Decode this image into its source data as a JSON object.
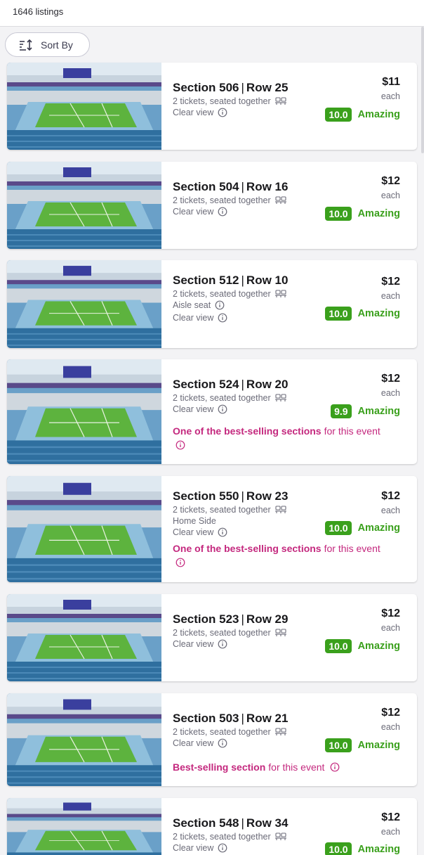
{
  "header": {
    "listing_count": "1646 listings"
  },
  "sort": {
    "label": "Sort By"
  },
  "colors": {
    "accent_green": "#3aa01c",
    "highlight_pink": "#c4287e"
  },
  "listings": [
    {
      "section": "Section 506",
      "row": "Row 25",
      "tickets": "2 tickets, seated together",
      "feature1": "Clear view",
      "feature2": "",
      "price": "$11",
      "each": "each",
      "score": "10.0",
      "rating_word": "Amazing",
      "best_bold": "",
      "best_rest": ""
    },
    {
      "section": "Section 504",
      "row": "Row 16",
      "tickets": "2 tickets, seated together",
      "feature1": "Clear view",
      "feature2": "",
      "price": "$12",
      "each": "each",
      "score": "10.0",
      "rating_word": "Amazing",
      "best_bold": "",
      "best_rest": ""
    },
    {
      "section": "Section 512",
      "row": "Row 10",
      "tickets": "2 tickets, seated together",
      "feature1": "Aisle seat",
      "feature2": "Clear view",
      "price": "$12",
      "each": "each",
      "score": "10.0",
      "rating_word": "Amazing",
      "best_bold": "",
      "best_rest": ""
    },
    {
      "section": "Section 524",
      "row": "Row 20",
      "tickets": "2 tickets, seated together",
      "feature1": "Clear view",
      "feature2": "",
      "price": "$12",
      "each": "each",
      "score": "9.9",
      "rating_word": "Amazing",
      "best_bold": "One of the best-selling sections",
      "best_rest": "for this event"
    },
    {
      "section": "Section 550",
      "row": "Row 23",
      "tickets": "2 tickets, seated together",
      "feature1": "Home Side",
      "feature2": "Clear view",
      "price": "$12",
      "each": "each",
      "score": "10.0",
      "rating_word": "Amazing",
      "best_bold": "One of the best-selling sections",
      "best_rest": "for this event"
    },
    {
      "section": "Section 523",
      "row": "Row 29",
      "tickets": "2 tickets, seated together",
      "feature1": "Clear view",
      "feature2": "",
      "price": "$12",
      "each": "each",
      "score": "10.0",
      "rating_word": "Amazing",
      "best_bold": "",
      "best_rest": ""
    },
    {
      "section": "Section 503",
      "row": "Row 21",
      "tickets": "2 tickets, seated together",
      "feature1": "Clear view",
      "feature2": "",
      "price": "$12",
      "each": "each",
      "score": "10.0",
      "rating_word": "Amazing",
      "best_bold": "Best-selling section",
      "best_rest": "for this event"
    },
    {
      "section": "Section 548",
      "row": "Row 34",
      "tickets": "2 tickets, seated together",
      "feature1": "Clear view",
      "feature2": "",
      "price": "$12",
      "each": "each",
      "score": "10.0",
      "rating_word": "Amazing",
      "best_bold": "",
      "best_rest": ""
    }
  ]
}
